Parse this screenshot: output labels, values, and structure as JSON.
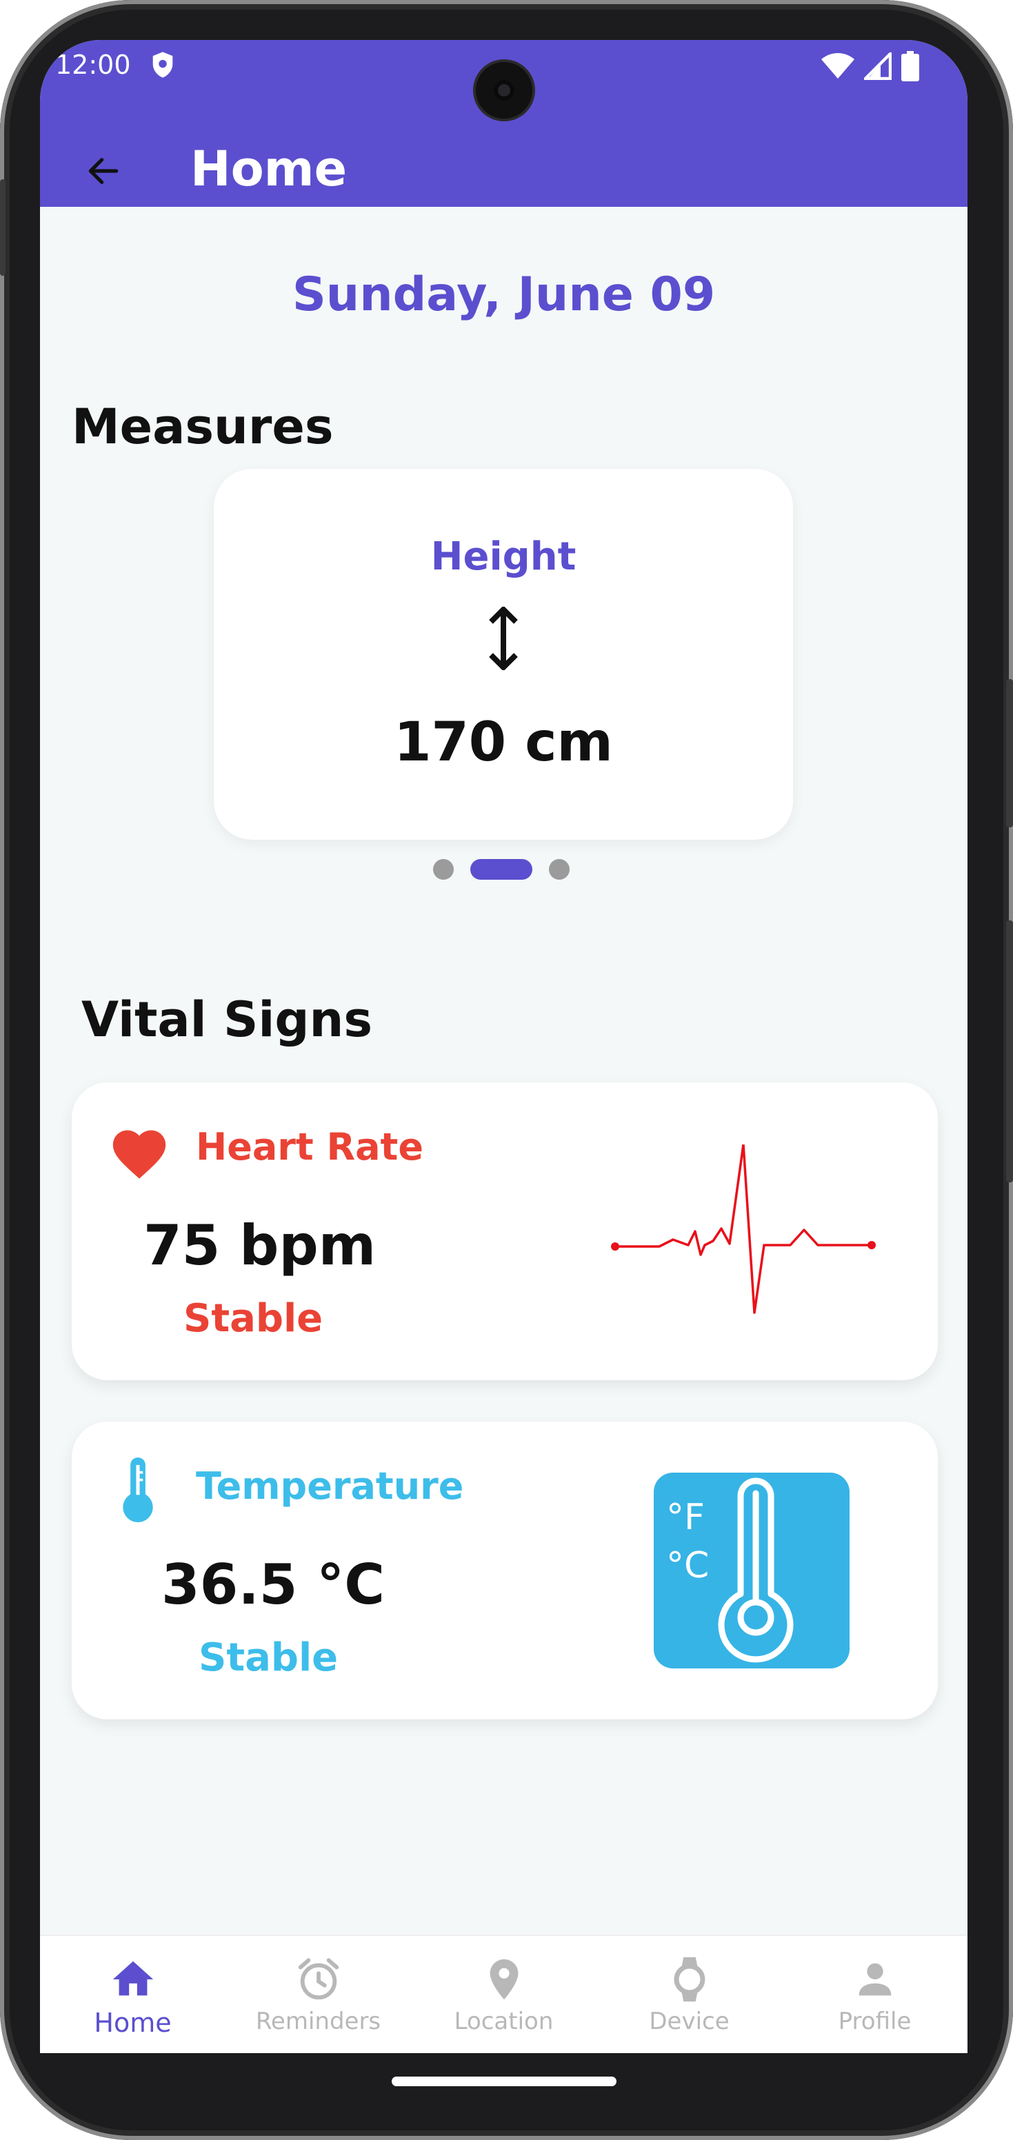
{
  "status_bar": {
    "time": "12:00"
  },
  "app_bar": {
    "title": "Home"
  },
  "date": "Sunday, June 09",
  "sections": {
    "measures": "Measures",
    "vital_signs": "Vital Signs"
  },
  "measure_card": {
    "label": "Height",
    "value": "170 cm",
    "icon": "vertical-arrows-icon"
  },
  "carousel": {
    "page_count": 3,
    "active_index": 1
  },
  "heart_rate": {
    "label": "Heart Rate",
    "value": "75 bpm",
    "status": "Stable",
    "color": "#ea4335",
    "icon": "heart-icon"
  },
  "temperature": {
    "label": "Temperature",
    "value": "36.5 °C",
    "status": "Stable",
    "color": "#3dbdea",
    "icon": "thermometer-icon",
    "tile_labels": {
      "f": "°F",
      "c": "°C"
    }
  },
  "bottom_nav": {
    "items": [
      {
        "label": "Home",
        "icon": "home-icon",
        "active": true
      },
      {
        "label": "Reminders",
        "icon": "alarm-clock-icon",
        "active": false
      },
      {
        "label": "Location",
        "icon": "location-pin-icon",
        "active": false
      },
      {
        "label": "Device",
        "icon": "watch-icon",
        "active": false
      },
      {
        "label": "Profile",
        "icon": "person-icon",
        "active": false
      }
    ]
  },
  "colors": {
    "primary": "#5b4fcf",
    "background": "#f4f8f8",
    "heart": "#ea4335",
    "temperature": "#3dbdea",
    "inactive": "#b8b8b8"
  }
}
